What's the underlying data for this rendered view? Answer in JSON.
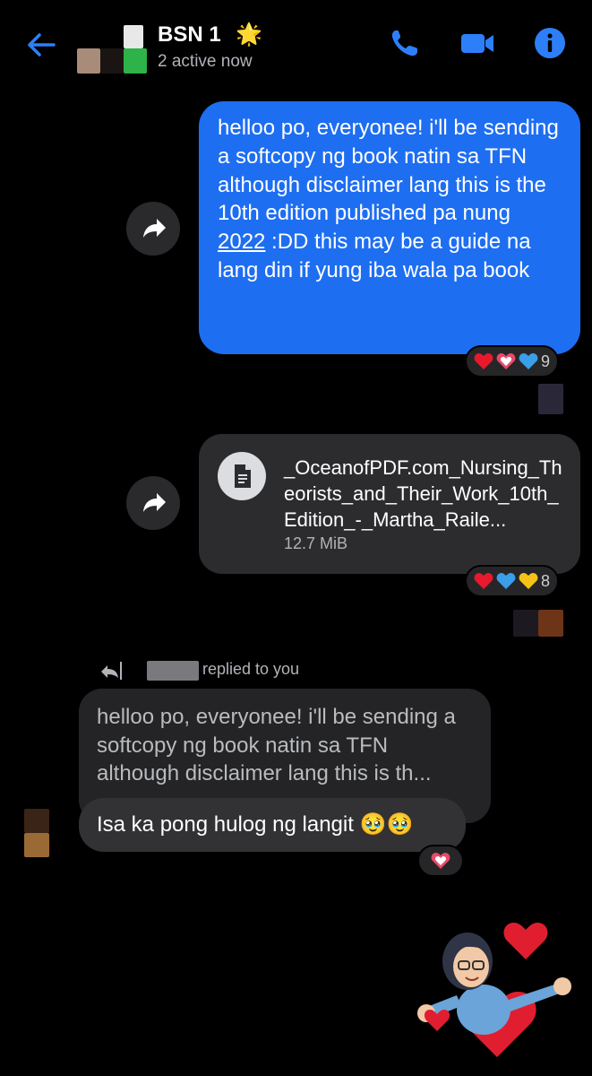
{
  "header": {
    "title": "BSN 1",
    "title_emoji": "🌟",
    "status": "2 active now"
  },
  "messages": {
    "first_text_a": "helloo po, everyonee! i'll be sending a softcopy ng book natin sa TFN although disclaimer lang this is the 10th edition published pa nung ",
    "first_text_link": "2022",
    "first_text_b": " :DD this may be a guide na lang din if yung iba wala pa book",
    "first_reaction_count": "9",
    "file_name": "_OceanofPDF.com_Nursing_Theorists_and_Their_Work_10th_Edition_-_Martha_Raile...",
    "file_size": "12.7 MiB",
    "file_reaction_count": "8",
    "reply_note": "replied to you",
    "quoted_text": "helloo po, everyonee! i'll be sending a softcopy ng book natin sa TFN although disclaimer lang this is th...",
    "reply_text": "Isa ka pong hulog ng langit 🥹🥹"
  },
  "colors": {
    "accent": "#1e6ef2",
    "background": "#000000"
  }
}
